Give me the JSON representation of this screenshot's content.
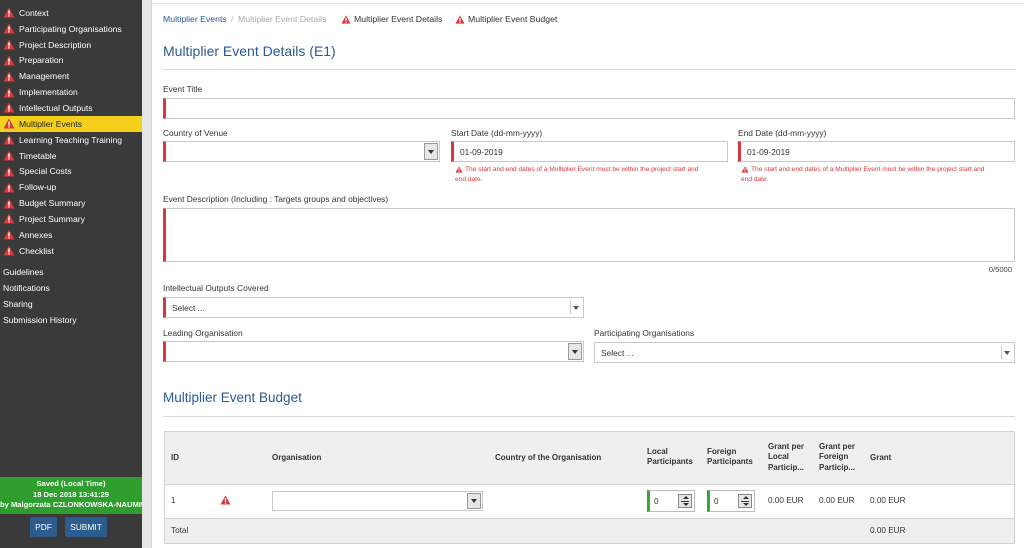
{
  "sidebar": {
    "items": [
      {
        "label": "Context",
        "warning": true,
        "active": false
      },
      {
        "label": "Participating Organisations",
        "warning": true,
        "active": false
      },
      {
        "label": "Project Description",
        "warning": true,
        "active": false
      },
      {
        "label": "Preparation",
        "warning": true,
        "active": false
      },
      {
        "label": "Management",
        "warning": true,
        "active": false
      },
      {
        "label": "Implementation",
        "warning": true,
        "active": false
      },
      {
        "label": "Intellectual Outputs",
        "warning": true,
        "active": false
      },
      {
        "label": "Multiplier Events",
        "warning": true,
        "active": true
      },
      {
        "label": "Learning Teaching Training",
        "warning": true,
        "active": false
      },
      {
        "label": "Timetable",
        "warning": true,
        "active": false
      },
      {
        "label": "Special Costs",
        "warning": true,
        "active": false
      },
      {
        "label": "Follow-up",
        "warning": true,
        "active": false
      },
      {
        "label": "Budget Summary",
        "warning": true,
        "active": false
      },
      {
        "label": "Project Summary",
        "warning": true,
        "active": false
      },
      {
        "label": "Annexes",
        "warning": true,
        "active": false
      },
      {
        "label": "Checklist",
        "warning": true,
        "active": false
      }
    ],
    "links": [
      "Guidelines",
      "Notifications",
      "Sharing",
      "Submission History"
    ],
    "saved": {
      "line1": "Saved (Local Time)",
      "line2": "18 Dec 2018 13:41:29",
      "line3": "by Malgorzata CZLONKOWSKA-NAUMIUK"
    },
    "pdf_label": "PDF",
    "submit_label": "SUBMIT"
  },
  "breadcrumb": {
    "link": "Multiplier Events",
    "separator": "/",
    "current": "Multiplier Event Details",
    "tab1": "Multiplier Event Details",
    "tab2": "Multiplier Event Budget"
  },
  "details": {
    "title": "Multiplier Event Details (E1)",
    "event_title_label": "Event Title",
    "event_title_value": "",
    "country_label": "Country of Venue",
    "country_value": "",
    "start_label": "Start Date (dd-mm-yyyy)",
    "start_value": "01-09-2019",
    "end_label": "End Date (dd-mm-yyyy)",
    "end_value": "01-09-2019",
    "date_error_line1": "The start and end dates of a Multiplier Event must be within the project start and",
    "date_error_line2": "end date.",
    "description_label": "Event Description (Including : Targets groups and objectives)",
    "description_value": "",
    "description_counter": "0/5000",
    "io_label": "Intellectual Outputs Covered",
    "io_value": "Select ...",
    "leading_label": "Leading Organisation",
    "leading_value": "",
    "participating_label": "Participating Organisations",
    "participating_value": "Select ..."
  },
  "budget": {
    "title": "Multiplier Event Budget",
    "headers": {
      "id": "ID",
      "org": "Organisation",
      "country": "Country of the Organisation",
      "local": [
        "Local",
        "Participants"
      ],
      "foreign": [
        "Foreign",
        "Participants"
      ],
      "grant_local": [
        "Grant per",
        "Local",
        "Particip..."
      ],
      "grant_foreign": [
        "Grant per",
        "Foreign",
        "Particip..."
      ],
      "grant": "Grant"
    },
    "row": {
      "id": "1",
      "org": "",
      "country": "",
      "local": "0",
      "foreign": "0",
      "grant_local": "0.00 EUR",
      "grant_foreign": "0.00 EUR",
      "grant": "0.00 EUR"
    },
    "total_label": "Total",
    "total_value": "0.00 EUR"
  },
  "colors": {
    "sidebar_bg": "#3a3a3a",
    "active_bg": "#f4d01d",
    "accent_blue": "#2a5a93",
    "error_red": "#d9373c",
    "saved_green": "#2e9e2e",
    "input_ok_green": "#3aa53a"
  },
  "icons": {
    "warning": "warning-triangle-icon",
    "dropdown": "chevron-down-icon",
    "spinner": "stepper-icon"
  }
}
